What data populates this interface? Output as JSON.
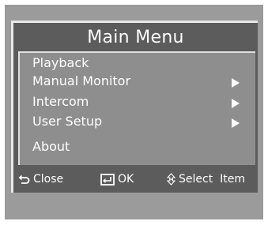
{
  "menu": {
    "title": "Main Menu",
    "items": [
      {
        "label": "Playback",
        "has_submenu": false
      },
      {
        "label": "Manual Monitor",
        "has_submenu": true
      },
      {
        "label": "Intercom",
        "has_submenu": true
      },
      {
        "label": "User Setup",
        "has_submenu": true
      },
      {
        "label": "About",
        "has_submenu": false
      }
    ]
  },
  "footer": {
    "close_label": "Close",
    "ok_label": "OK",
    "select_label": "Select  Item",
    "close_icon": "back-arrow-icon",
    "ok_icon": "enter-icon",
    "select_icon": "up-down-arrows-icon"
  },
  "colors": {
    "frame": "#9b9b9b",
    "panel": "#5c5c5c",
    "menu_area": "#8e8e8e",
    "text": "#ffffff"
  }
}
